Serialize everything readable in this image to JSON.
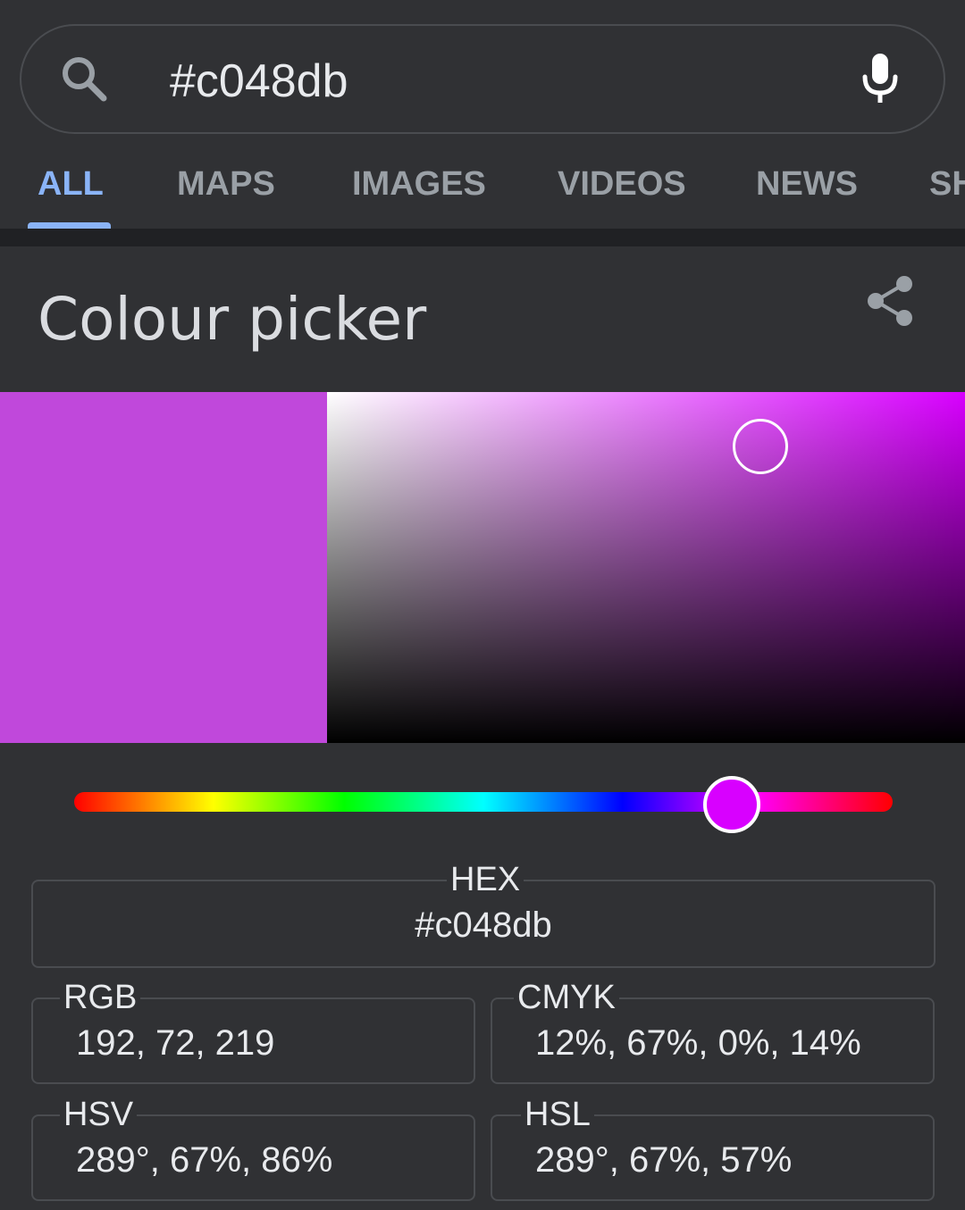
{
  "search": {
    "query": "#c048db",
    "icon": "search-icon",
    "mic_icon": "mic-icon"
  },
  "tabs": [
    {
      "label": "ALL",
      "active": true
    },
    {
      "label": "MAPS",
      "active": false
    },
    {
      "label": "IMAGES",
      "active": false
    },
    {
      "label": "VIDEOS",
      "active": false
    },
    {
      "label": "NEWS",
      "active": false
    },
    {
      "label": "SHOPPING",
      "active": false
    }
  ],
  "card": {
    "title": "Colour picker",
    "share_icon": "share-icon"
  },
  "picker": {
    "selected_color": "#c048db",
    "hue_color": "#d800ff",
    "saturation": 0.67,
    "value": 0.86,
    "hue_degrees": 289
  },
  "fields": {
    "hex": {
      "label": "HEX",
      "value": "#c048db"
    },
    "rgb": {
      "label": "RGB",
      "value": "192, 72, 219"
    },
    "cmyk": {
      "label": "CMYK",
      "value": "12%, 67%, 0%, 14%"
    },
    "hsv": {
      "label": "HSV",
      "value": "289°, 67%, 86%"
    },
    "hsl": {
      "label": "HSL",
      "value": "289°, 67%, 57%"
    }
  },
  "colors": {
    "accent": "#8ab4f8",
    "background": "#303134"
  }
}
